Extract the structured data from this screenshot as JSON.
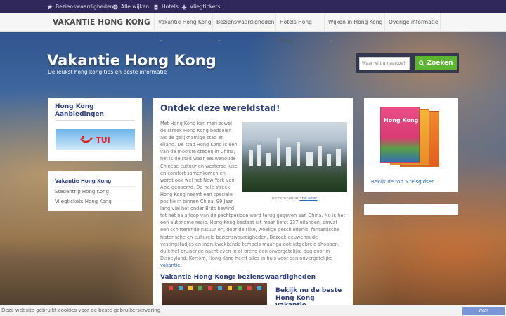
{
  "topbar": {
    "links": [
      {
        "label": "Bezienswaardigheden",
        "icon": "star-icon"
      },
      {
        "label": "Alle wijken",
        "icon": "globe-icon"
      },
      {
        "label": "Hotels",
        "icon": "building-icon"
      },
      {
        "label": "Vliegtickets",
        "icon": "plane-icon"
      }
    ]
  },
  "navbar": {
    "brand": "VAKANTIE HONG KONG",
    "items": [
      {
        "label": "Vakantie Hong Kong",
        "dropdown": true
      },
      {
        "label": "Bezienswaardigheden",
        "dropdown": true
      },
      {
        "label": "Hotels Hong Kong",
        "dropdown": false
      },
      {
        "label": "Wijken in Hong Kong",
        "dropdown": true
      },
      {
        "label": "Overige informatie",
        "dropdown": true
      }
    ]
  },
  "hero": {
    "title": "Vakantie Hong Kong",
    "subtitle": "De leukst hong kong tips en beste informatie"
  },
  "search": {
    "placeholder": "Waar wilt u naartoe?",
    "button_label": "Zoeken"
  },
  "left_sidebar": {
    "offers_title": "Hong Kong Aanbiedingen",
    "tui_logo_text": "TUI",
    "menu": [
      {
        "label": "Vakantie Hong Kong",
        "active": true
      },
      {
        "label": "Stedentrip Hong Kong",
        "active": false
      },
      {
        "label": "Vliegtickets Hong Kong",
        "active": false
      }
    ]
  },
  "main": {
    "title": "Ontdek deze wereldstad!",
    "paragraph_1": "Met Hong Kong kan men zowel de streek Hong Kong bedoelen als de gelijknamige stad en eiland. De stad Hong Kong is één van de mooiste steden in China; het is de stad waar eeuwenoude Chinese cultuur en westerse luxe en comfort samenkomen en wordt ook wel het New York van Azië genoemd. De hele streek Hong Kong neemt een speciale positie in binnen China. 99 Jaar lang viel het onder Brits bewind tot het na afloop van de pachtperiode werd terug gegeven aan China. Nu is het een autonome regio. Hong Kong bestaat uit maar liefst 237 eilanden, omvat een schitterende natuur en, door de rijke, woelige geschiedenis, fantastische historische en culturele bezienswaardigheden. Bezoek eeuwenoude vestingstadjes en indrukwekkende tempels maar ga ook uitgebreid shoppen, duik het bruisende nachtleven in of breng een onvergetelijke dag door in Disneyland. Kortom, Hong Kong heeft alles in huis voor een onvergetelijke ",
    "paragraph_link": "vakantie",
    "paragraph_end": "!",
    "caption_prefix": "Uitzicht vanaf ",
    "caption_link": "The Peak",
    "section_title": "Vakantie Hong Kong: bezienswaardigheden",
    "cta_title": "Bekijk nu de beste Hong Kong vakantie"
  },
  "right_sidebar": {
    "guides_link": "Bekijk de top 5 reisgidsen",
    "book_cover_title": "Hong Kong"
  },
  "cookie": {
    "message": "Deze website gebruikt cookies voor de beste gebruikerservaring",
    "ok_label": "OK!"
  },
  "colors": {
    "topbar": "#30275a",
    "heading": "#2c3e7a",
    "link": "#2c6ab1",
    "search_button": "#5bb52e",
    "tui_red": "#d8232a",
    "cookie_button": "#7b96d6"
  }
}
